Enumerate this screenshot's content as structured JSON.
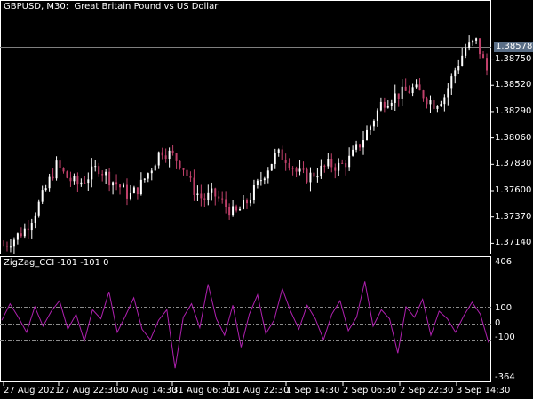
{
  "header": {
    "symbol_timeframe": "GBPUSD, M30:",
    "description": "Great Britain Pound vs US Dollar"
  },
  "indicator": {
    "name": "ZigZag_CCI",
    "values": "-101 -101 0"
  },
  "colors": {
    "background": "#000000",
    "candle_bull": "#ffffff",
    "candle_bear": "#c0406a",
    "indicator_line": "#b020b0",
    "current_price_line": "#7f7f7f",
    "current_price_tag": "#5a6e86",
    "level_line": "#8c8c8c"
  },
  "chart_data": [
    {
      "type": "candlestick",
      "title": "GBPUSD, M30:  Great Britain Pound vs US Dollar",
      "ylim": [
        1.3705,
        1.3925
      ],
      "y_ticks": [
        "1.38750",
        "1.38520",
        "1.38290",
        "1.38060",
        "1.37830",
        "1.37600",
        "1.37370",
        "1.37140"
      ],
      "current_price": "1.38578",
      "close_path": [
        1.3712,
        1.3718,
        1.3726,
        1.3741,
        1.3761,
        1.3782,
        1.3772,
        1.3765,
        1.3772,
        1.3781,
        1.3771,
        1.3764,
        1.3755,
        1.3764,
        1.3779,
        1.3796,
        1.3791,
        1.3783,
        1.3762,
        1.3752,
        1.3757,
        1.3748,
        1.3739,
        1.3748,
        1.3762,
        1.3778,
        1.3792,
        1.3788,
        1.3775,
        1.3772,
        1.3777,
        1.3783,
        1.3781,
        1.3788,
        1.3802,
        1.3818,
        1.3837,
        1.3842,
        1.3845,
        1.3849,
        1.3843,
        1.3836,
        1.3843,
        1.3866,
        1.3885,
        1.389,
        1.3865
      ]
    },
    {
      "type": "line",
      "title": "ZigZag_CCI -101 -101 0",
      "ylim": [
        -364,
        406
      ],
      "y_ticks": [
        "406",
        "100",
        "0",
        "-100",
        "-364"
      ],
      "levels": [
        100,
        0,
        -100
      ],
      "values": [
        20,
        130,
        40,
        -60,
        110,
        -20,
        80,
        150,
        -40,
        60,
        -120,
        90,
        30,
        210,
        -60,
        50,
        170,
        -40,
        -110,
        20,
        90,
        -300,
        40,
        130,
        -30,
        260,
        30,
        -80,
        120,
        -160,
        60,
        190,
        -70,
        20,
        230,
        80,
        -40,
        120,
        30,
        -110,
        60,
        150,
        -50,
        40,
        280,
        -20,
        90,
        30,
        -200,
        110,
        40,
        160,
        -80,
        80,
        30,
        -60,
        50,
        140,
        60,
        -130
      ]
    }
  ],
  "x_axis": {
    "ticks": [
      "27 Aug 2021",
      "27 Aug 22:30",
      "30 Aug 14:30",
      "31 Aug 06:30",
      "31 Aug 22:30",
      "1 Sep 14:30",
      "2 Sep 06:30",
      "2 Sep 22:30",
      "3 Sep 14:30"
    ]
  }
}
